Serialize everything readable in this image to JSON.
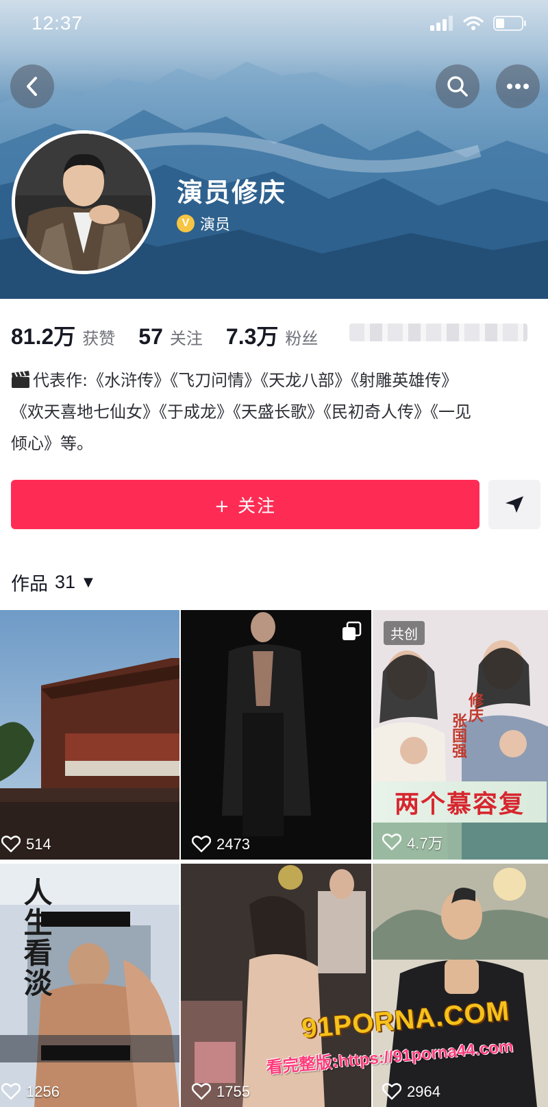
{
  "status_bar": {
    "time": "12:37"
  },
  "header": {
    "back_icon": "chevron-left-icon",
    "search_icon": "search-icon",
    "more_icon": "more-dots-icon"
  },
  "profile": {
    "name": "演员修庆",
    "verified_label": "演员",
    "verified_badge": "V"
  },
  "stats": [
    {
      "value": "81.2万",
      "label": "获赞"
    },
    {
      "value": "57",
      "label": "关注"
    },
    {
      "value": "7.3万",
      "label": "粉丝"
    }
  ],
  "bio": {
    "line1": "代表作:《水浒传》《飞刀问情》《天龙八部》《射雕英雄传》",
    "line2": "《欢天喜地七仙女》《于成龙》《天盛长歌》《民初奇人传》《一见",
    "line3": "倾心》等。"
  },
  "actions": {
    "follow_label": "+ 关注",
    "share_icon": "send-arrow-icon"
  },
  "works": {
    "label": "作品",
    "count": "31",
    "caret": "▼"
  },
  "videos": [
    {
      "likes": "514"
    },
    {
      "likes": "2473"
    },
    {
      "likes": "4.7万",
      "tag": "共创",
      "caption": "两个慕容复",
      "name_a": "张国强",
      "name_b": "修庆"
    },
    {
      "likes": "1256",
      "vertical_title": "人生看淡"
    },
    {
      "likes": "1755"
    },
    {
      "likes": "2964"
    }
  ],
  "watermark": {
    "logo": "91PORNA.COM",
    "prefix": "看完整版:",
    "url": "https://91porna44.com"
  },
  "colors": {
    "follow_button": "#fe2c55",
    "text_primary": "#161823",
    "text_secondary": "#6f7079"
  }
}
